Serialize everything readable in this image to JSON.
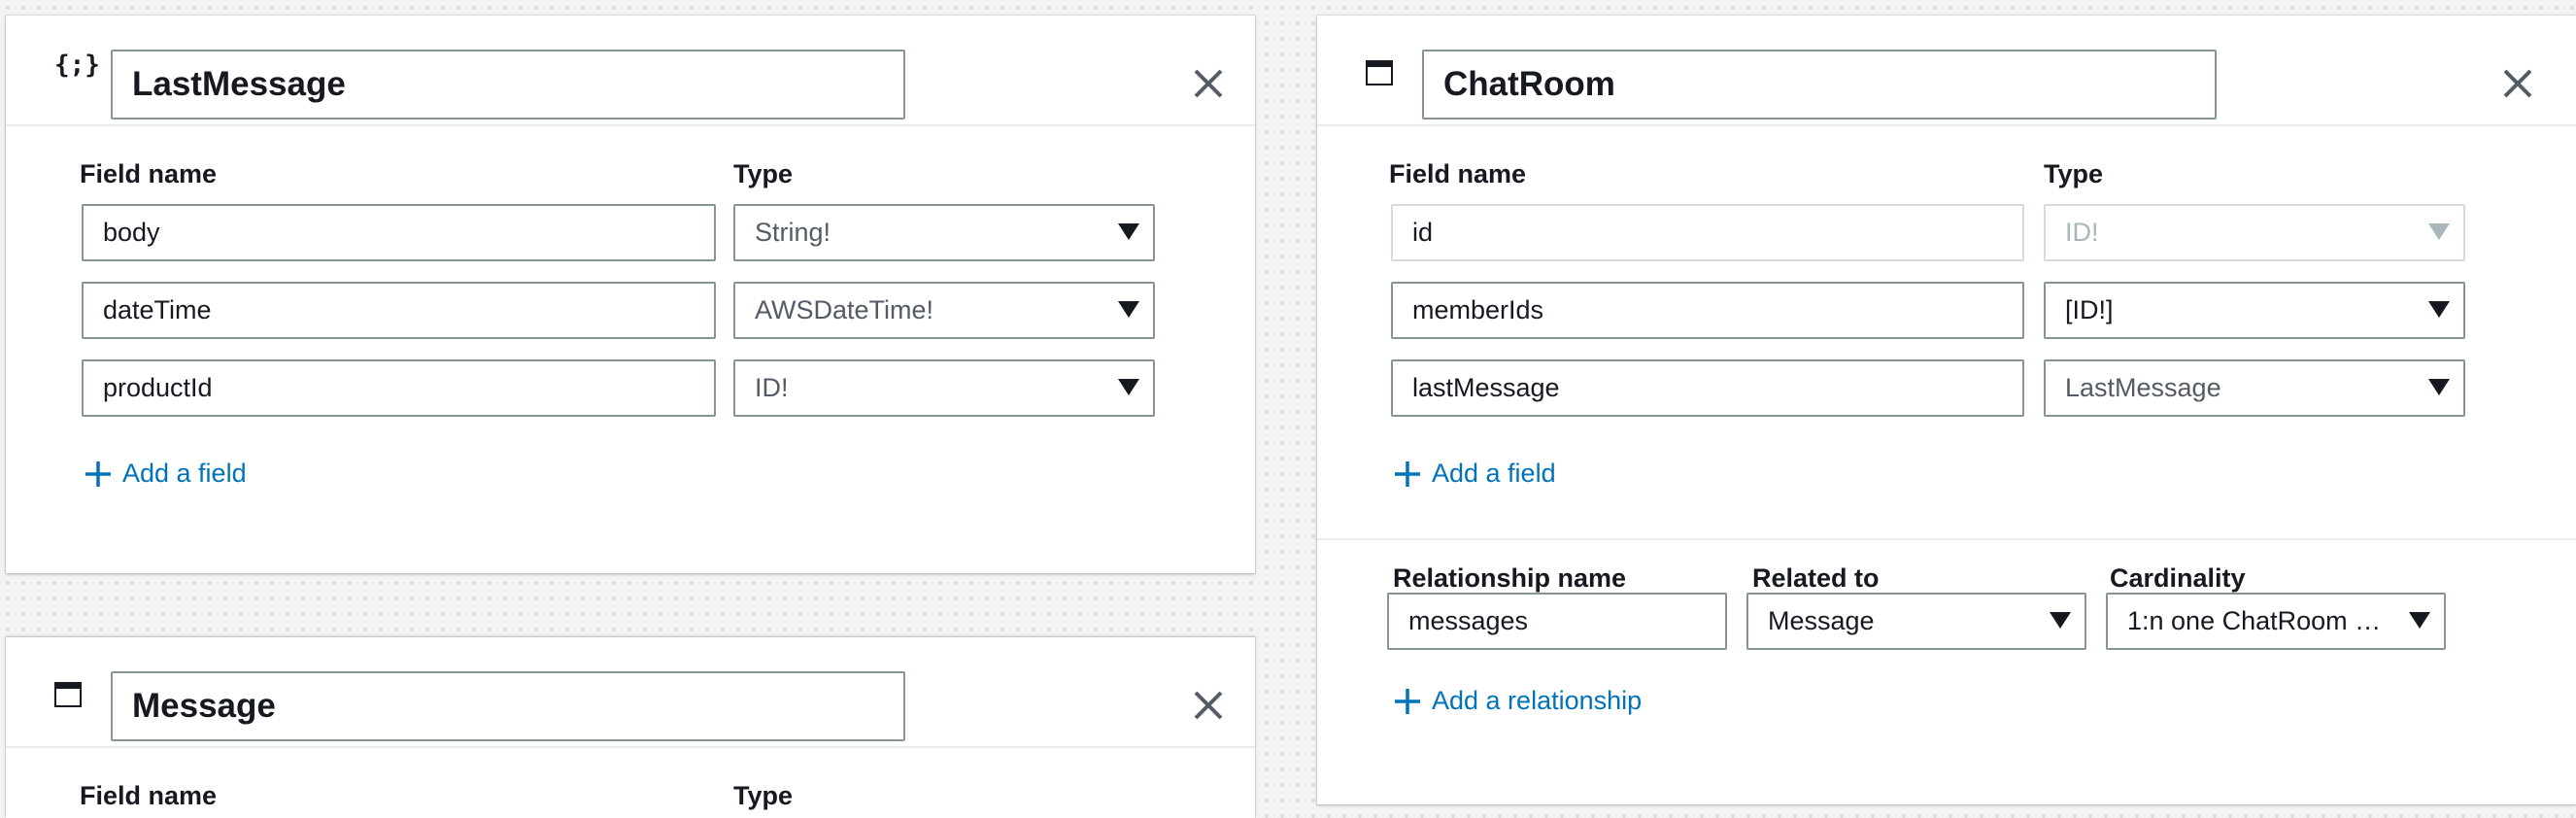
{
  "cards": {
    "last_message": {
      "type_icon": "{;}",
      "name": "LastMessage",
      "field_name_header": "Field name",
      "type_header": "Type",
      "fields": [
        {
          "name": "body",
          "type": "String!"
        },
        {
          "name": "dateTime",
          "type": "AWSDateTime!"
        },
        {
          "name": "productId",
          "type": "ID!"
        }
      ],
      "add_field_label": "Add a field"
    },
    "message": {
      "name": "Message",
      "field_name_header": "Field name",
      "type_header": "Type"
    },
    "chat_room": {
      "name": "ChatRoom",
      "field_name_header": "Field name",
      "type_header": "Type",
      "fields": [
        {
          "name": "id",
          "type": "ID!",
          "disabled": true
        },
        {
          "name": "memberIds",
          "type": "[ID!]"
        },
        {
          "name": "lastMessage",
          "type": "LastMessage"
        }
      ],
      "add_field_label": "Add a field",
      "relationship_name_header": "Relationship name",
      "related_to_header": "Related to",
      "cardinality_header": "Cardinality",
      "relationships": [
        {
          "name": "messages",
          "related_to": "Message",
          "cardinality": "1:n one ChatRoom …"
        }
      ],
      "add_relationship_label": "Add a relationship"
    }
  },
  "icons": {
    "close": "close-icon",
    "plus": "plus-icon",
    "caret": "chevron-down-icon",
    "window": "window-icon"
  },
  "colors": {
    "link": "#0073bb",
    "text": "#16191f",
    "border": "#879596",
    "disabled": "#aab7b8",
    "canvas": "#f2f3f3"
  }
}
